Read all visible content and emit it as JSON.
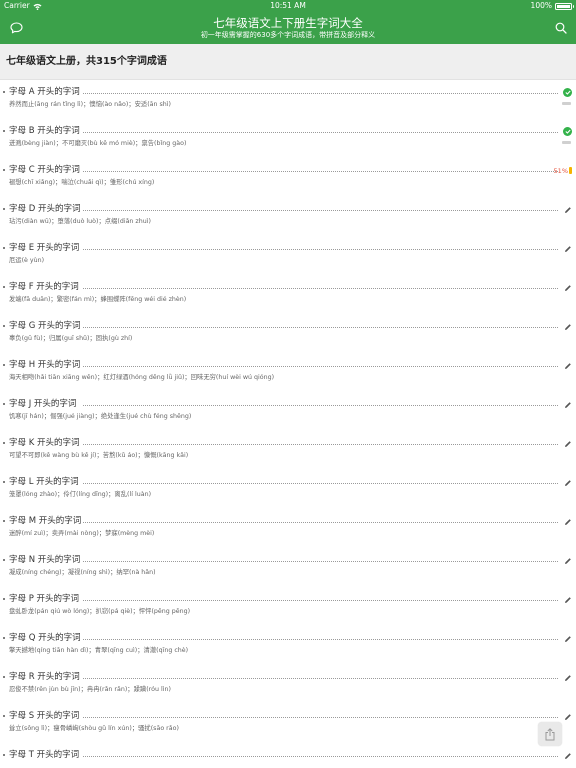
{
  "status_bar": {
    "carrier": "Carrier",
    "time": "10:51 AM",
    "battery": "100%"
  },
  "nav": {
    "title": "七年级语文上下册生字词大全",
    "subtitle": "初一年级需掌握的630多个字词成语，带拼音及部分释义",
    "left_icon": "chat-bubble-icon",
    "right_icon": "search-icon"
  },
  "section": {
    "title": "七年级语文上册，共315个字词成语"
  },
  "rows": [
    {
      "heading": "字母 A 开头的字词",
      "words": "养然而止(āng rán tǐng lì)；懊恼(ào nǎo)；安适(ān shì)",
      "status": "done"
    },
    {
      "heading": "字母 B 开头的字词",
      "words": "迸溅(bèng jiàn)；不可磨灭(bù kě mó miè)；禀告(bǐng gào)",
      "status": "done"
    },
    {
      "heading": "字母 C 开头的字词",
      "words": "褪想(chī xiǎng)；喘泣(chuǎi qì)；雏形(chú xíng)",
      "status": "partial",
      "percent": "51%"
    },
    {
      "heading": "字母 D 开头的字词",
      "words": "玷污(diàn wū)；堕落(duò luò)；点缀(diǎn zhuì)",
      "status": "edit"
    },
    {
      "heading": "字母 E 开头的字词",
      "words": "厄运(è yùn)",
      "status": "edit"
    },
    {
      "heading": "字母 F 开头的字词",
      "words": "发端(fā duān)；繁密(fán mì)；蜂围蝶阵(fēng wéi dié zhèn)",
      "status": "edit"
    },
    {
      "heading": "字母 G 开头的字词",
      "words": "辜负(gū fù)；归属(guī shǔ)；固执(gù zhí)",
      "status": "edit"
    },
    {
      "heading": "字母 H 开头的字词",
      "words": "海天相吻(hǎi tiān xiāng wěn)；红灯绿酒(hóng dēng lǜ jiǔ)；回味无穷(huí wèi wú qióng)",
      "status": "edit"
    },
    {
      "heading": "字母 J 开头的字词",
      "words": "饥寒(jī hán)；倔强(jué jiàng)；绝处逢生(jué chù féng shēng)",
      "status": "edit"
    },
    {
      "heading": "字母 K 开头的字词",
      "words": "可望不可即(kě wàng bù kě jí)；苦熬(kǔ áo)；慷慨(kāng kǎi)",
      "status": "edit"
    },
    {
      "heading": "字母 L 开头的字词",
      "words": "笼罩(lóng zhào)；伶仃(líng dīng)；离乱(lí luàn)",
      "status": "edit"
    },
    {
      "heading": "字母 M 开头的字词",
      "words": "迷醉(mí zuì)；卖弄(mài nòng)；梦寐(mèng mèi)",
      "status": "edit"
    },
    {
      "heading": "字母 N 开头的字词",
      "words": "凝成(níng chéng)；凝视(níng shì)；纳罕(nà hǎn)",
      "status": "edit"
    },
    {
      "heading": "字母 P 开头的字词",
      "words": "盘虬卧龙(pán qiú wò lóng)；扒窃(pá qiè)；怦怦(pēng pēng)",
      "status": "edit"
    },
    {
      "heading": "字母 Q 开头的字词",
      "words": "擎天撼地(qíng tiān hàn dì)；青翠(qīng cuì)；清澈(qīng chè)",
      "status": "edit"
    },
    {
      "heading": "字母 R 开头的字词",
      "words": "忍俊不禁(rěn jùn bù jīn)；冉冉(rǎn rǎn)；蹂躏(róu lìn)",
      "status": "edit"
    },
    {
      "heading": "字母 S 开头的字词",
      "words": "耸立(sǒng lì)；瘦骨嶙峋(shòu gǔ lín xún)；骚扰(sāo rǎo)",
      "status": "edit"
    },
    {
      "heading": "字母 T 开头的字词",
      "words": "",
      "status": "edit"
    }
  ],
  "share_icon": "share-icon",
  "colors": {
    "brand_green": "#3ba14a",
    "check_green": "#33b24a",
    "percent_red": "#e5533d",
    "partial_yellow": "#f5b400"
  }
}
